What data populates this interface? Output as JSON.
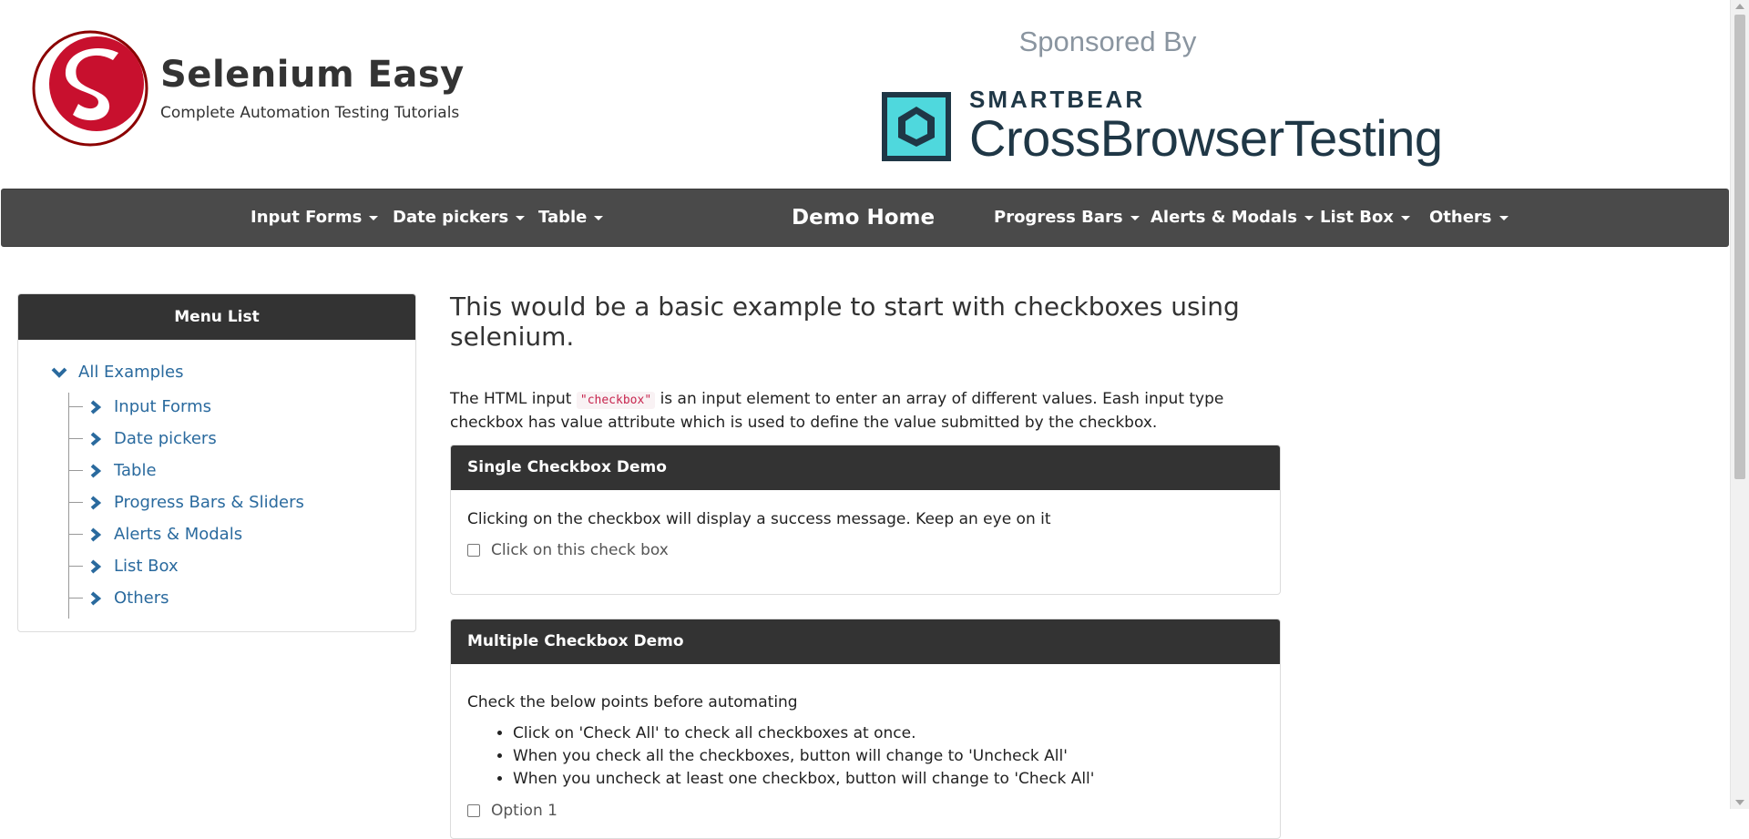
{
  "brand": {
    "title": "Selenium Easy",
    "subtitle": "Complete Automation Testing Tutorials",
    "logo_colors": {
      "primary": "#c8102e",
      "dark": "#8b0000"
    }
  },
  "sponsor": {
    "label": "Sponsored By",
    "company_small": "SMARTBEAR",
    "company_big": "CrossBrowserTesting",
    "icon": "crossbrowsertesting-logo-icon",
    "accent": "#4fd8dd"
  },
  "navbar": {
    "brand": "Demo Home",
    "left_items": [
      "Input Forms",
      "Date pickers",
      "Table"
    ],
    "right_items": [
      "Progress Bars",
      "Alerts & Modals",
      "List Box",
      "Others"
    ]
  },
  "sidebar": {
    "title": "Menu List",
    "root": "All Examples",
    "items": [
      "Input Forms",
      "Date pickers",
      "Table",
      "Progress Bars & Sliders",
      "Alerts & Modals",
      "List Box",
      "Others"
    ]
  },
  "main": {
    "heading": "This would be a basic example to start with checkboxes using selenium.",
    "intro_before": "The HTML input",
    "intro_code": "\"checkbox\"",
    "intro_after": "is an input element to enter an array of different values. Eash input type checkbox has value attribute which is used to define the value submitted by the checkbox."
  },
  "single_panel": {
    "title": "Single Checkbox Demo",
    "description": "Clicking on the checkbox will display a success message. Keep an eye on it",
    "checkbox_label": "Click on this check box"
  },
  "multiple_panel": {
    "title": "Multiple Checkbox Demo",
    "description": "Check the below points before automating",
    "points": [
      "Click on 'Check All' to check all checkboxes at once.",
      "When you check all the checkboxes, button will change to 'Uncheck All'",
      "When you uncheck at least one checkbox, button will change to 'Check All'"
    ],
    "option_1": "Option 1"
  },
  "colors": {
    "navbar": "#4a4a4a",
    "panel_head": "#333333",
    "link": "#2a6a9e"
  }
}
